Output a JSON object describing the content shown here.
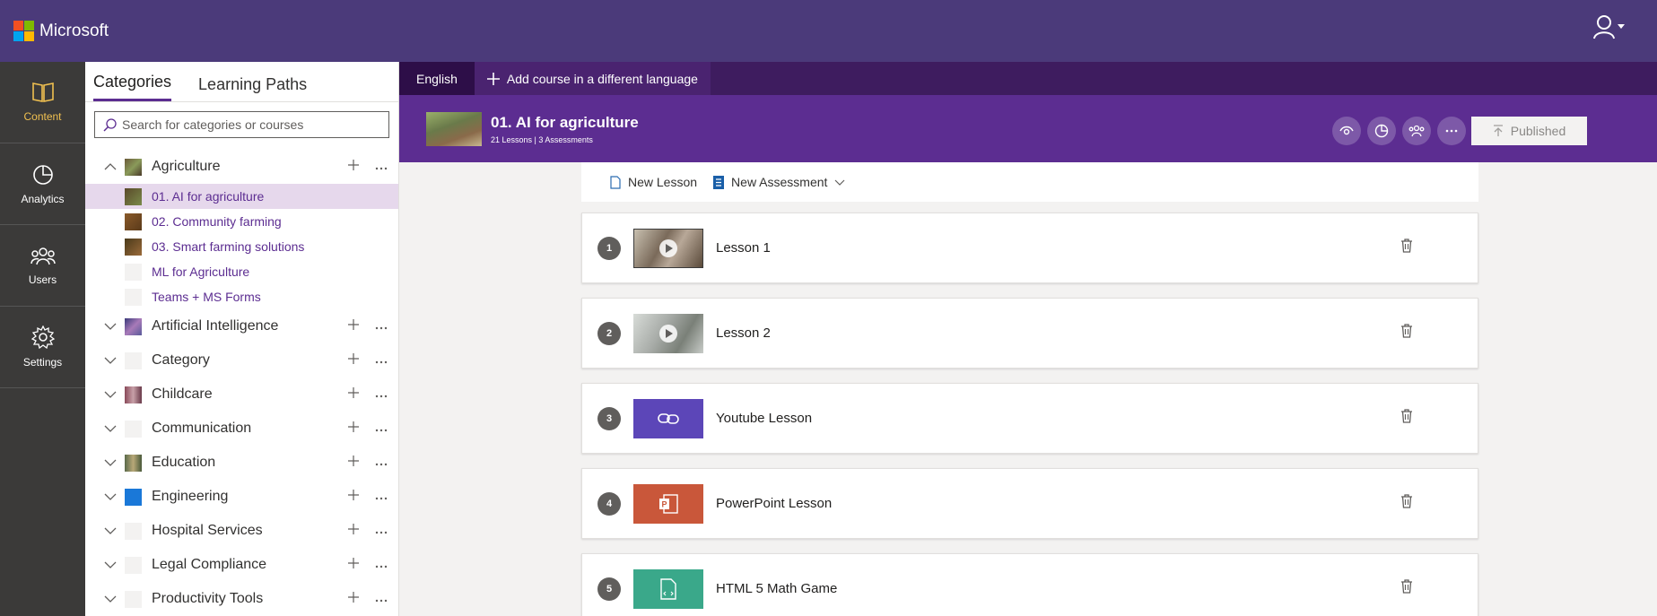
{
  "header": {
    "brand": "Microsoft",
    "logo_colors": [
      "#f25022",
      "#7fba00",
      "#00a4ef",
      "#ffb900"
    ],
    "user_icon": "user-icon"
  },
  "leftnav": {
    "items": [
      {
        "label": "Content",
        "icon": "book-icon",
        "active": true
      },
      {
        "label": "Analytics",
        "icon": "pie-chart-icon",
        "active": false
      },
      {
        "label": "Users",
        "icon": "users-icon",
        "active": false
      },
      {
        "label": "Settings",
        "icon": "gear-icon",
        "active": false
      }
    ]
  },
  "catpanel": {
    "tabs": [
      "Categories",
      "Learning Paths"
    ],
    "search_placeholder": "Search for categories or courses",
    "categories": [
      {
        "label": "Agriculture",
        "expanded": true
      },
      {
        "label": "Artificial Intelligence"
      },
      {
        "label": "Category"
      },
      {
        "label": "Childcare"
      },
      {
        "label": "Communication"
      },
      {
        "label": "Education"
      },
      {
        "label": "Engineering"
      },
      {
        "label": "Hospital Services"
      },
      {
        "label": "Legal Compliance"
      },
      {
        "label": "Productivity Tools"
      }
    ],
    "courses": [
      {
        "label": "01. AI for agriculture",
        "selected": true
      },
      {
        "label": "02. Community farming"
      },
      {
        "label": "03. Smart farming solutions"
      },
      {
        "label": "ML for Agriculture"
      },
      {
        "label": "Teams + MS Forms"
      }
    ]
  },
  "langbar": {
    "language": "English",
    "add_language": "Add course in a different language"
  },
  "course": {
    "title": "01. AI for agriculture",
    "subtitle": "21 Lessons | 3 Assessments",
    "status": "Published"
  },
  "toolbar": {
    "new_lesson": "New Lesson",
    "new_assessment": "New Assessment"
  },
  "lessons": [
    {
      "num": "1",
      "title": "Lesson 1",
      "type": "video"
    },
    {
      "num": "2",
      "title": "Lesson 2",
      "type": "video"
    },
    {
      "num": "3",
      "title": "Youtube Lesson",
      "type": "link",
      "color": "#5c46b8"
    },
    {
      "num": "4",
      "title": "PowerPoint Lesson",
      "type": "powerpoint",
      "color": "#c9573a"
    },
    {
      "num": "5",
      "title": "HTML 5 Math Game",
      "type": "html",
      "color": "#3aa88a"
    }
  ],
  "colors": {
    "topbar": "#4b3a7a",
    "accent": "#5c2d91",
    "nav_active": "#f0c050"
  }
}
